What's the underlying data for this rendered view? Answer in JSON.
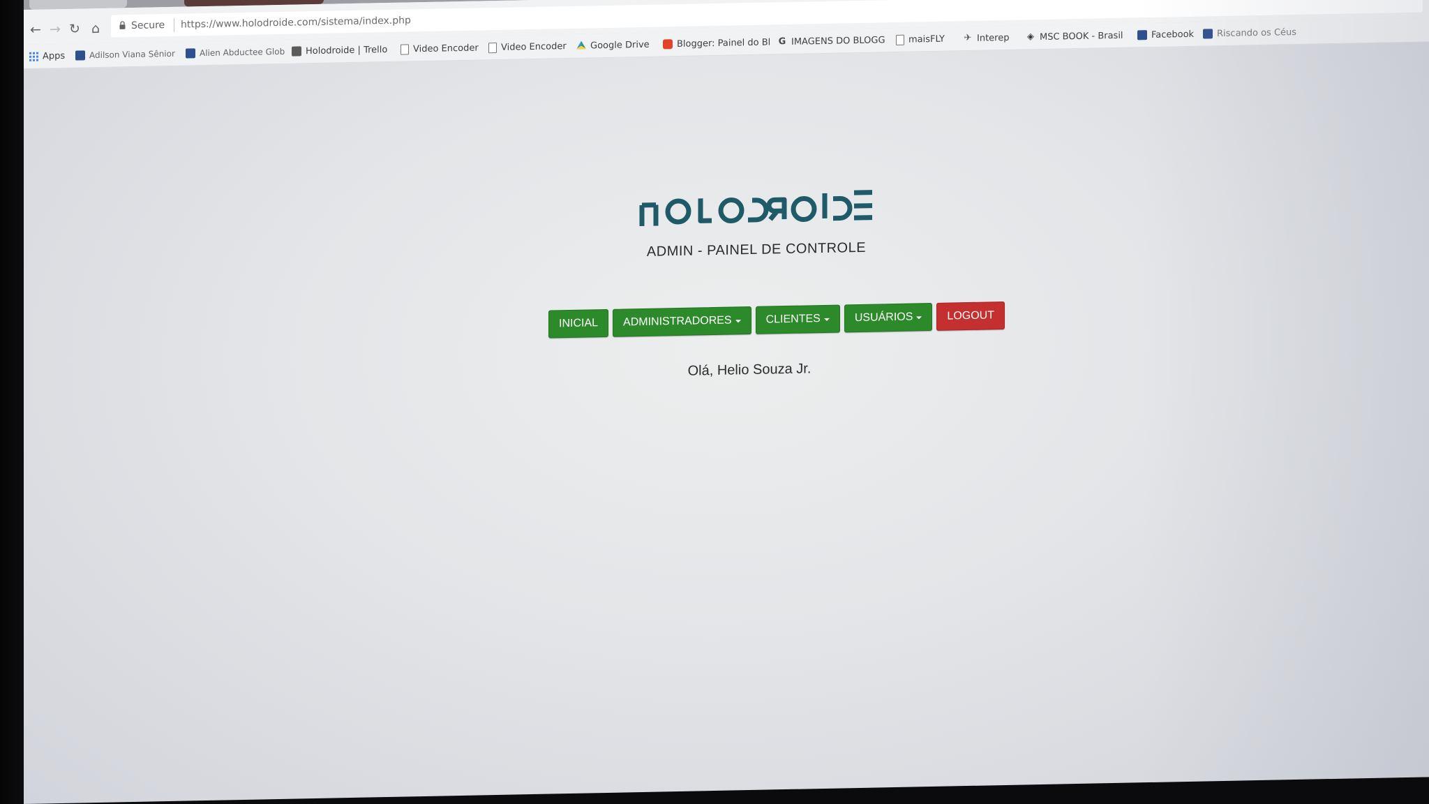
{
  "browser": {
    "secure_label": "Secure",
    "url": "https://www.holodroide.com/sistema/index.php",
    "bookmarks": [
      {
        "label": "Apps",
        "icon": "apps-grid-icon"
      },
      {
        "label": "Adilson Viana Sênior",
        "icon": "facebook-icon"
      },
      {
        "label": "Alien Abductee Glob",
        "icon": "facebook-icon"
      },
      {
        "label": "Holodroide | Trello",
        "icon": "trello-icon"
      },
      {
        "label": "Video Encoder",
        "icon": "document-icon"
      },
      {
        "label": "Video Encoder",
        "icon": "document-icon"
      },
      {
        "label": "Google Drive",
        "icon": "google-drive-icon"
      },
      {
        "label": "Blogger: Painel do Bl",
        "icon": "blogger-icon"
      },
      {
        "label": "IMAGENS DO BLOGG",
        "icon": "google-icon"
      },
      {
        "label": "maisFLY",
        "icon": "document-icon"
      },
      {
        "label": "Interep",
        "icon": "plane-icon"
      },
      {
        "label": "MSC BOOK - Brasil",
        "icon": "msc-icon"
      },
      {
        "label": "Facebook",
        "icon": "facebook-icon"
      },
      {
        "label": "Riscando os Céus",
        "icon": "facebook-icon"
      }
    ]
  },
  "page": {
    "logo_text": "HOLODROIDE",
    "subtitle": "ADMIN - PAINEL DE CONTROLE",
    "menu": {
      "inicial": "INICIAL",
      "administradores": "ADMINISTRADORES",
      "clientes": "CLIENTES",
      "usuarios": "USUÁRIOS",
      "logout": "LOGOUT"
    },
    "greeting": "Olá, Helio Souza Jr."
  },
  "colors": {
    "logo": "#1e5a68",
    "button_green": "#2c8a2b",
    "button_red": "#c42f2f"
  }
}
